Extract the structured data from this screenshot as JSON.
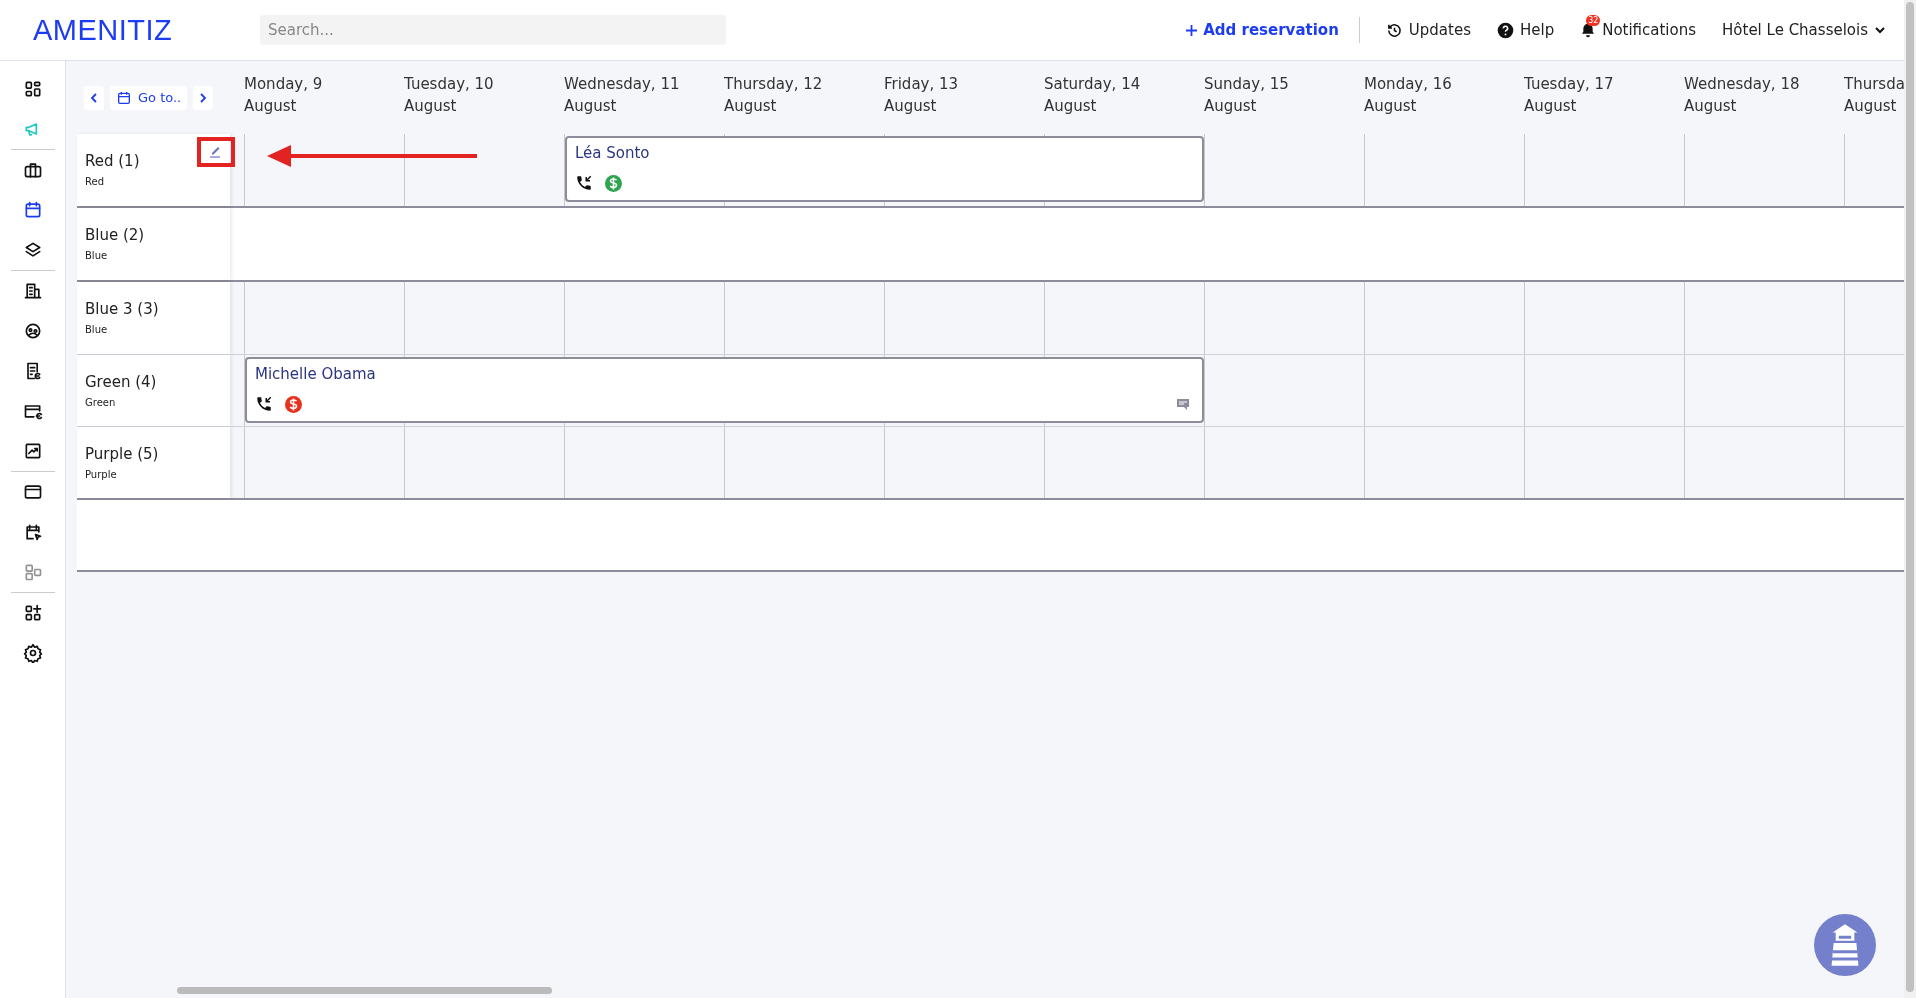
{
  "logo": "AMENITIZ",
  "search": {
    "placeholder": "Search..."
  },
  "top_actions": {
    "add_reservation": "Add reservation",
    "updates": "Updates",
    "help": "Help",
    "notifications": "Notifications",
    "notifications_badge": "32",
    "hotel": "Hôtel Le Chasselois"
  },
  "sidebar": {
    "groups": [
      [
        {
          "selected": false,
          "disabled": false
        },
        {
          "selected": false,
          "disabled": false
        }
      ],
      [
        {
          "selected": false,
          "disabled": false
        },
        {
          "selected": true,
          "disabled": false
        },
        {
          "selected": false,
          "disabled": false
        }
      ],
      [
        {
          "selected": false,
          "disabled": false
        },
        {
          "selected": false,
          "disabled": false
        },
        {
          "selected": false,
          "disabled": false
        },
        {
          "selected": false,
          "disabled": false
        },
        {
          "selected": false,
          "disabled": false
        }
      ],
      [
        {
          "selected": false,
          "disabled": false
        },
        {
          "selected": false,
          "disabled": false
        },
        {
          "selected": false,
          "disabled": true
        }
      ],
      [
        {
          "selected": false,
          "disabled": false
        },
        {
          "selected": false,
          "disabled": false
        }
      ]
    ]
  },
  "calendar": {
    "goto": "Go to..",
    "days": [
      {
        "day": "Monday, 9",
        "month": "August"
      },
      {
        "day": "Tuesday, 10",
        "month": "August"
      },
      {
        "day": "Wednesday, 11",
        "month": "August"
      },
      {
        "day": "Thursday, 12",
        "month": "August"
      },
      {
        "day": "Friday, 13",
        "month": "August"
      },
      {
        "day": "Saturday, 14",
        "month": "August"
      },
      {
        "day": "Sunday, 15",
        "month": "August"
      },
      {
        "day": "Monday, 16",
        "month": "August"
      },
      {
        "day": "Tuesday, 17",
        "month": "August"
      },
      {
        "day": "Wednesday, 18",
        "month": "August"
      },
      {
        "day": "Thursda",
        "month": "August"
      }
    ],
    "room_groups": [
      {
        "rooms": [
          {
            "name": "Red (1)",
            "type": "Red",
            "kind": "grid",
            "editable": true,
            "bookings": [
              {
                "guest": "Léa Sonto",
                "paid": true,
                "comment": false
              }
            ]
          }
        ]
      },
      {
        "rooms": [
          {
            "name": "Blue (2)",
            "type": "Blue",
            "kind": "blank",
            "editable": false
          }
        ]
      },
      {
        "rooms": [
          {
            "name": "Blue 3 (3)",
            "type": "Blue",
            "kind": "grid",
            "editable": false
          },
          {
            "name": "Green (4)",
            "type": "Green",
            "kind": "grid",
            "editable": false,
            "bookings": [
              {
                "guest": "Michelle Obama",
                "paid": false,
                "comment": true
              }
            ]
          },
          {
            "name": "Purple (5)",
            "type": "Purple",
            "kind": "grid",
            "editable": false
          }
        ]
      }
    ]
  }
}
